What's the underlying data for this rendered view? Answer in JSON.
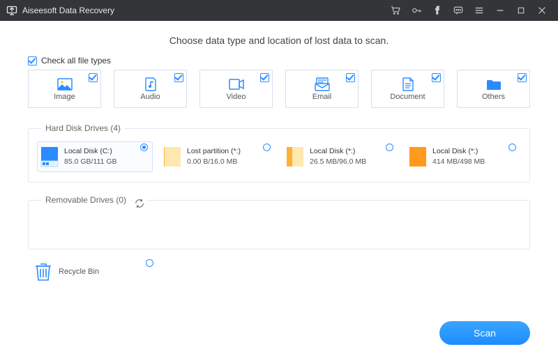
{
  "app": {
    "title": "Aiseesoft Data Recovery"
  },
  "subtitle": "Choose data type and location of lost data to scan.",
  "checkall_label": "Check all file types",
  "types": {
    "image": "Image",
    "audio": "Audio",
    "video": "Video",
    "email": "Email",
    "document": "Document",
    "others": "Others"
  },
  "hdd": {
    "legend": "Hard Disk Drives (4)",
    "items": [
      {
        "name": "Local Disk (C:)",
        "size": "85.0 GB/111 GB"
      },
      {
        "name": "Lost partition (*:)",
        "size": "0.00  B/16.0 MB"
      },
      {
        "name": "Local Disk (*:)",
        "size": "26.5 MB/96.0 MB"
      },
      {
        "name": "Local Disk (*:)",
        "size": "414 MB/498 MB"
      }
    ]
  },
  "removable": {
    "legend": "Removable Drives (0)"
  },
  "recycle": {
    "label": "Recycle Bin"
  },
  "scan_label": "Scan",
  "colors": {
    "accent": "#2a8cff",
    "orange": "#ffb033",
    "orange2": "#ff9a1f",
    "yellow": "#ffe8b0"
  }
}
